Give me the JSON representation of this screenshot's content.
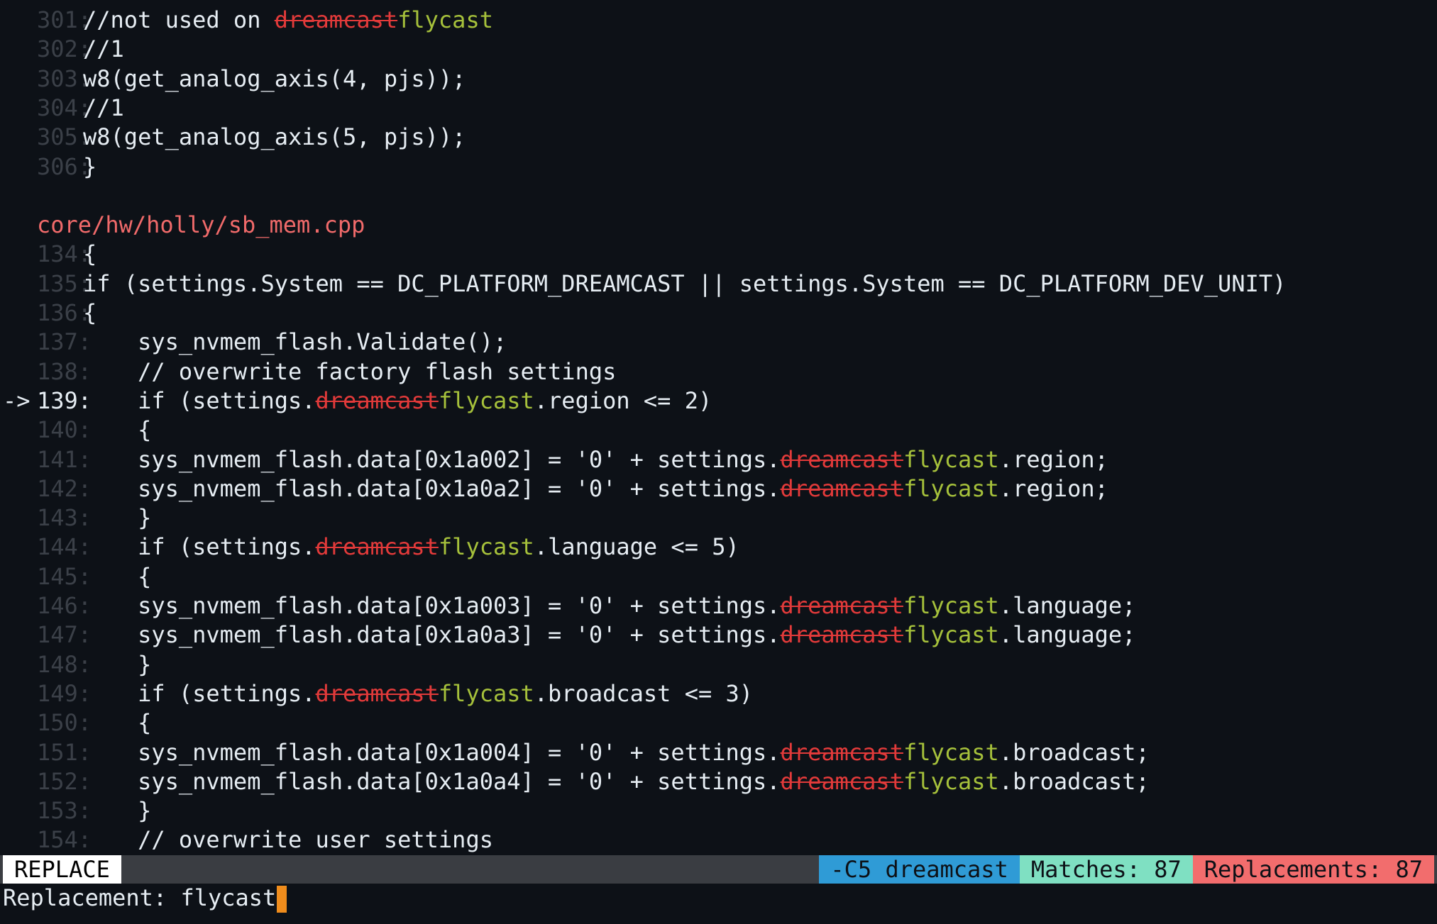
{
  "sections": [
    {
      "lines": [
        {
          "num": "301:",
          "parts": [
            {
              "t": "//not used on "
            },
            {
              "t": "dreamcast",
              "k": "del"
            },
            {
              "t": "flycast",
              "k": "ins"
            }
          ]
        },
        {
          "num": "302:",
          "parts": [
            {
              "t": "//1"
            }
          ]
        },
        {
          "num": "303:",
          "parts": [
            {
              "t": "w8(get_analog_axis(4, pjs));"
            }
          ]
        },
        {
          "num": "304:",
          "parts": [
            {
              "t": "//1"
            }
          ]
        },
        {
          "num": "305:",
          "parts": [
            {
              "t": "w8(get_analog_axis(5, pjs));"
            }
          ]
        },
        {
          "num": "306:",
          "parts": [
            {
              "t": "}"
            }
          ]
        }
      ]
    },
    {
      "file": "core/hw/holly/sb_mem.cpp",
      "lines": [
        {
          "num": "134:",
          "parts": [
            {
              "t": "{"
            }
          ]
        },
        {
          "num": "135:",
          "parts": [
            {
              "t": "if (settings.System == DC_PLATFORM_DREAMCAST || settings.System == DC_PLATFORM_DEV_UNIT)"
            }
          ]
        },
        {
          "num": "136:",
          "parts": [
            {
              "t": "{"
            }
          ]
        },
        {
          "num": "137:",
          "parts": [
            {
              "t": "    sys_nvmem_flash.Validate();"
            }
          ]
        },
        {
          "num": "138:",
          "parts": [
            {
              "t": "    // overwrite factory flash settings"
            }
          ]
        },
        {
          "num": "139:",
          "active": true,
          "marker": "->",
          "parts": [
            {
              "t": "    if (settings."
            },
            {
              "t": "dreamcast",
              "k": "del"
            },
            {
              "t": "flycast",
              "k": "ins"
            },
            {
              "t": ".region <= 2)"
            }
          ]
        },
        {
          "num": "140:",
          "parts": [
            {
              "t": "    {"
            }
          ]
        },
        {
          "num": "141:",
          "parts": [
            {
              "t": "    sys_nvmem_flash.data[0x1a002] = '0' + settings."
            },
            {
              "t": "dreamcast",
              "k": "del"
            },
            {
              "t": "flycast",
              "k": "ins"
            },
            {
              "t": ".region;"
            }
          ]
        },
        {
          "num": "142:",
          "parts": [
            {
              "t": "    sys_nvmem_flash.data[0x1a0a2] = '0' + settings."
            },
            {
              "t": "dreamcast",
              "k": "del"
            },
            {
              "t": "flycast",
              "k": "ins"
            },
            {
              "t": ".region;"
            }
          ]
        },
        {
          "num": "143:",
          "parts": [
            {
              "t": "    }"
            }
          ]
        },
        {
          "num": "144:",
          "parts": [
            {
              "t": "    if (settings."
            },
            {
              "t": "dreamcast",
              "k": "del"
            },
            {
              "t": "flycast",
              "k": "ins"
            },
            {
              "t": ".language <= 5)"
            }
          ]
        },
        {
          "num": "145:",
          "parts": [
            {
              "t": "    {"
            }
          ]
        },
        {
          "num": "146:",
          "parts": [
            {
              "t": "    sys_nvmem_flash.data[0x1a003] = '0' + settings."
            },
            {
              "t": "dreamcast",
              "k": "del"
            },
            {
              "t": "flycast",
              "k": "ins"
            },
            {
              "t": ".language;"
            }
          ]
        },
        {
          "num": "147:",
          "parts": [
            {
              "t": "    sys_nvmem_flash.data[0x1a0a3] = '0' + settings."
            },
            {
              "t": "dreamcast",
              "k": "del"
            },
            {
              "t": "flycast",
              "k": "ins"
            },
            {
              "t": ".language;"
            }
          ]
        },
        {
          "num": "148:",
          "parts": [
            {
              "t": "    }"
            }
          ]
        },
        {
          "num": "149:",
          "parts": [
            {
              "t": "    if (settings."
            },
            {
              "t": "dreamcast",
              "k": "del"
            },
            {
              "t": "flycast",
              "k": "ins"
            },
            {
              "t": ".broadcast <= 3)"
            }
          ]
        },
        {
          "num": "150:",
          "parts": [
            {
              "t": "    {"
            }
          ]
        },
        {
          "num": "151:",
          "parts": [
            {
              "t": "    sys_nvmem_flash.data[0x1a004] = '0' + settings."
            },
            {
              "t": "dreamcast",
              "k": "del"
            },
            {
              "t": "flycast",
              "k": "ins"
            },
            {
              "t": ".broadcast;"
            }
          ]
        },
        {
          "num": "152:",
          "parts": [
            {
              "t": "    sys_nvmem_flash.data[0x1a0a4] = '0' + settings."
            },
            {
              "t": "dreamcast",
              "k": "del"
            },
            {
              "t": "flycast",
              "k": "ins"
            },
            {
              "t": ".broadcast;"
            }
          ]
        },
        {
          "num": "153:",
          "parts": [
            {
              "t": "    }"
            }
          ]
        },
        {
          "num": "154:",
          "parts": [
            {
              "t": "    // overwrite user settings"
            }
          ]
        }
      ]
    }
  ],
  "status": {
    "mode": "REPLACE",
    "search": "-C5 dreamcast",
    "matches": "Matches: 87",
    "replacements": "Replacements: 87"
  },
  "prompt": {
    "label": "Replacement: ",
    "value": "flycast"
  },
  "colors": {
    "background": "#0d1117",
    "deleted": "#e23a3a",
    "inserted": "#a6c13b",
    "file_path": "#f06a6a",
    "cursor": "#ef8c1c",
    "search_segment": "#2f9bd6",
    "matches_segment": "#7fe0c2",
    "replacements_segment": "#f26d6d"
  }
}
